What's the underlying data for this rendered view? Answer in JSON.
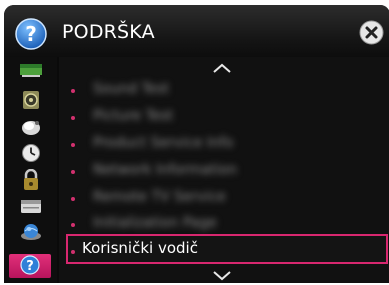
{
  "header": {
    "title": "PODRŠKA",
    "help_icon": "question-mark-circle-icon",
    "close_icon": "close-x-icon"
  },
  "sidebar": {
    "items": [
      {
        "icon": "picture-icon"
      },
      {
        "icon": "speaker-icon"
      },
      {
        "icon": "satellite-icon"
      },
      {
        "icon": "clock-icon"
      },
      {
        "icon": "lock-icon"
      },
      {
        "icon": "keyboard-icon"
      },
      {
        "icon": "network-globe-icon"
      },
      {
        "icon": "support-question-icon",
        "active": true
      }
    ]
  },
  "menu": {
    "up_icon": "chevron-up-icon",
    "down_icon": "chevron-down-icon",
    "items": [
      {
        "label": "Sound Test"
      },
      {
        "label": "Picture Test"
      },
      {
        "label": "Product Service Info"
      },
      {
        "label": "Network Information"
      },
      {
        "label": "Remote TV Service"
      },
      {
        "label": "Initialization Page"
      },
      {
        "label": "Korisnički vodič",
        "selected": true
      }
    ]
  },
  "colors": {
    "accent": "#d8276f",
    "background": "#0a0a0a",
    "help_blue": "#2f80d8"
  }
}
